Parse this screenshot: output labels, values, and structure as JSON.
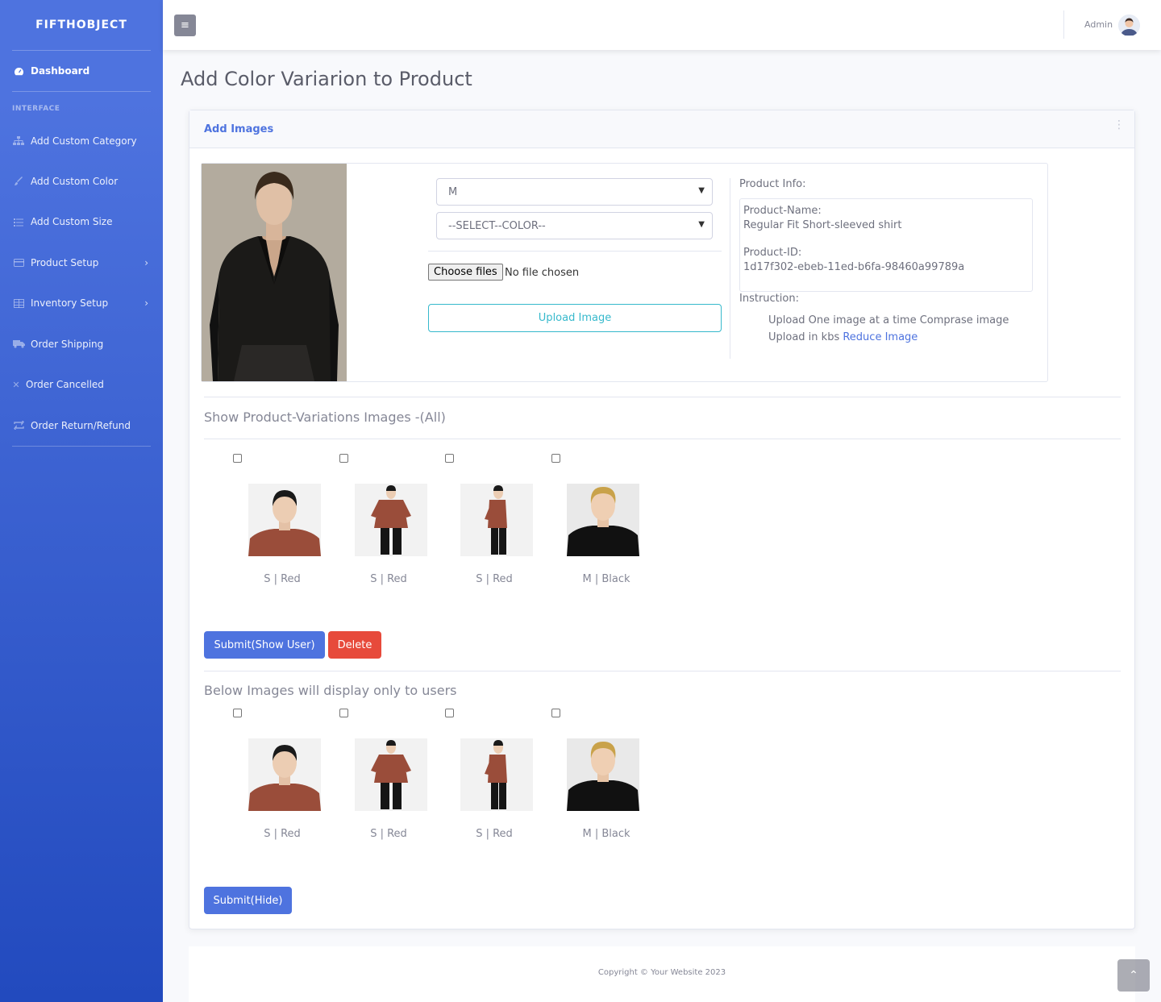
{
  "brand": "FIFTHOBJECT",
  "sidebar": {
    "dashboard": "Dashboard",
    "heading": "INTERFACE",
    "items": [
      {
        "label": "Add Custom Category",
        "icon": "sitemap-icon"
      },
      {
        "label": "Add Custom Color",
        "icon": "brush-icon"
      },
      {
        "label": "Add Custom Size",
        "icon": "list-icon"
      },
      {
        "label": "Product Setup",
        "icon": "card-icon",
        "chevron": true
      },
      {
        "label": "Inventory Setup",
        "icon": "table-icon",
        "chevron": true
      },
      {
        "label": "Order Shipping",
        "icon": "truck-icon"
      },
      {
        "label": "Order Cancelled",
        "icon": "close-icon"
      },
      {
        "label": "Order Return/Refund",
        "icon": "retweet-icon"
      }
    ]
  },
  "topbar": {
    "user": "Admin"
  },
  "page_title": "Add Color Variarion to Product",
  "card_title": "Add Images",
  "form": {
    "size_value": "M",
    "color_value": "--SELECT--COLOR--",
    "file_button": "Choose files",
    "file_status": "No file chosen",
    "upload_button": "Upload Image"
  },
  "product_info": {
    "label": "Product Info:",
    "name_label": "Product-Name:",
    "name": "Regular Fit Short-sleeved shirt",
    "id_label": "Product-ID:",
    "id": "1d17f302-ebeb-11ed-b6fa-98460a99789a",
    "instruction_label": "Instruction:",
    "instruction_line1": "Upload One image at a time Comprase image",
    "instruction_line2": "Upload in kbs ",
    "instruction_link": "Reduce Image"
  },
  "show_section": {
    "title": "Show Product-Variations Images -(All)",
    "images": [
      {
        "caption": "S | Red"
      },
      {
        "caption": "S | Red"
      },
      {
        "caption": "S | Red"
      },
      {
        "caption": "M | Black"
      }
    ],
    "submit": "Submit(Show User)",
    "delete": "Delete"
  },
  "user_section": {
    "title": "Below Images will display only to users",
    "images": [
      {
        "caption": "S | Red"
      },
      {
        "caption": "S | Red"
      },
      {
        "caption": "S | Red"
      },
      {
        "caption": "M | Black"
      }
    ],
    "submit": "Submit(Hide)"
  },
  "footer": "Copyright © Your Website 2023",
  "colors": {
    "primary": "#4e73df",
    "danger": "#e74a3b",
    "info": "#36b9cc"
  }
}
